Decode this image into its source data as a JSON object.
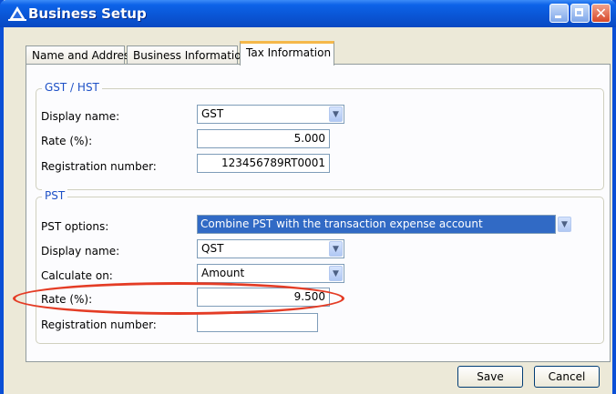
{
  "window": {
    "title": "Business Setup",
    "title_icon": "accounting-logo-icon",
    "controls": {
      "minimize_icon": "minimize-icon",
      "maximize_icon": "maximize-icon",
      "close_icon": "close-icon",
      "close_glyph": "✕"
    }
  },
  "tabs": [
    {
      "label": "Name and Address",
      "active": false
    },
    {
      "label": "Business Information",
      "active": false
    },
    {
      "label": "Tax Information",
      "active": true
    }
  ],
  "gst": {
    "group_label": "GST / HST",
    "display_name": {
      "label": "Display name:",
      "value": "GST"
    },
    "rate": {
      "label": "Rate (%):",
      "value": "5.000"
    },
    "registration": {
      "label": "Registration number:",
      "value": "123456789RT0001"
    }
  },
  "pst": {
    "group_label": "PST",
    "options": {
      "label": "PST options:",
      "value": "Combine PST with the transaction expense account"
    },
    "display_name": {
      "label": "Display name:",
      "value": "QST"
    },
    "calculate_on": {
      "label": "Calculate on:",
      "value": "Amount"
    },
    "rate": {
      "label": "Rate (%):",
      "value": "9.500"
    },
    "registration": {
      "label": "Registration number:",
      "value": ""
    }
  },
  "buttons": {
    "save": "Save",
    "cancel": "Cancel"
  },
  "dropdown_glyph": "▼",
  "annotation": {
    "shape": "ellipse",
    "color": "#e43c25",
    "target": "pst-rate"
  },
  "colors": {
    "title_bar": "#0a55d4",
    "group_label": "#1d50c6",
    "selection": "#316ac5",
    "active_tab_accent": "#f5b84a"
  }
}
